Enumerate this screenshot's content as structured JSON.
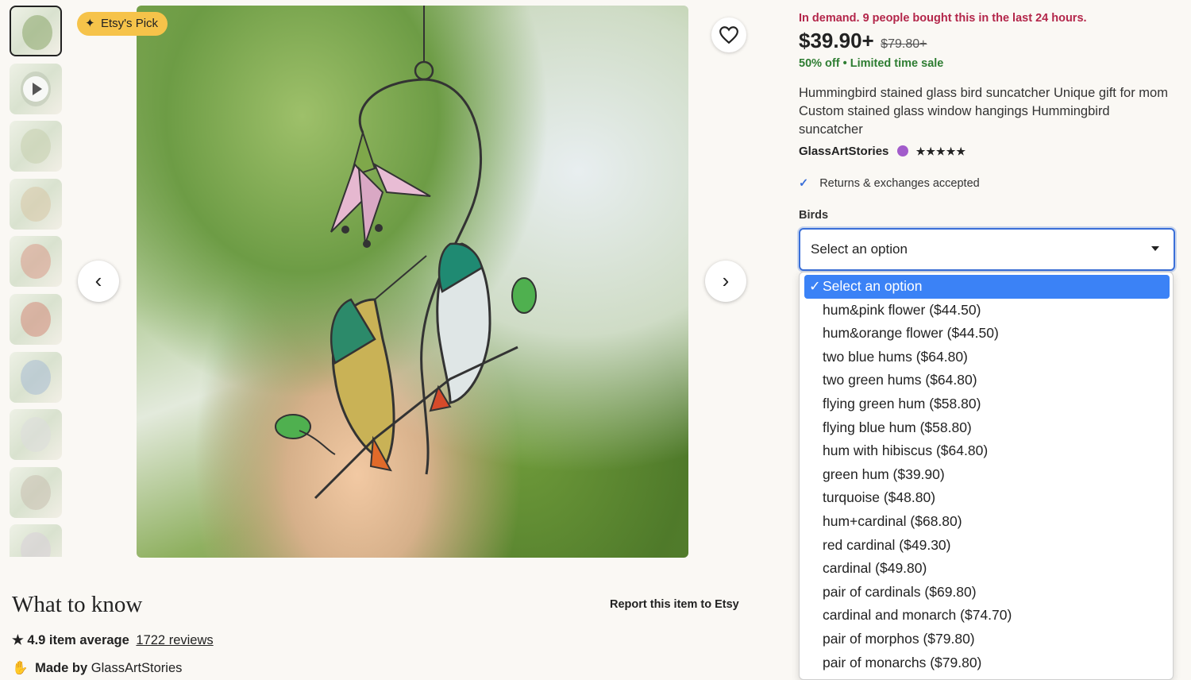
{
  "thumbnails": [
    {
      "kind": "image",
      "active": true,
      "color": "#8aa66a"
    },
    {
      "kind": "video",
      "active": false,
      "color": "#b9c3b0"
    },
    {
      "kind": "image",
      "active": false,
      "color": "#c7cfae"
    },
    {
      "kind": "image",
      "active": false,
      "color": "#d7c7a5"
    },
    {
      "kind": "image",
      "active": false,
      "color": "#d99a8a"
    },
    {
      "kind": "image",
      "active": false,
      "color": "#d48a7a"
    },
    {
      "kind": "image",
      "active": false,
      "color": "#a7bcd3"
    },
    {
      "kind": "image",
      "active": false,
      "color": "#dcdcdc"
    },
    {
      "kind": "image",
      "active": false,
      "color": "#c9c0b0"
    },
    {
      "kind": "image",
      "active": false,
      "color": "#d8d0d8"
    }
  ],
  "badge": {
    "label": "Etsy's Pick",
    "icon": "sparkle-icon"
  },
  "product": {
    "demand": "In demand. 9 people bought this in the last 24 hours.",
    "price": "$39.90+",
    "original_price": "$79.80+",
    "discount": "50% off",
    "sale_note": "Limited time sale",
    "title": "Hummingbird stained glass bird suncatcher Unique gift for mom Custom stained glass window hangings Hummingbird suncatcher",
    "shop": "GlassArtStories",
    "stars": "★★★★★",
    "returns": "Returns & exchanges accepted"
  },
  "variation": {
    "label": "Birds",
    "selected": "Select an option",
    "options": [
      "Select an option",
      "hum&pink flower ($44.50)",
      "hum&orange flower ($44.50)",
      "two blue hums ($64.80)",
      "two green hums ($64.80)",
      "flying green hum ($58.80)",
      "flying blue hum ($58.80)",
      "hum with hibiscus ($64.80)",
      "green hum ($39.90)",
      "turquoise ($48.80)",
      "hum+cardinal ($68.80)",
      "red cardinal ($49.30)",
      "cardinal ($49.80)",
      "pair of cardinals ($69.80)",
      "cardinal and monarch ($74.70)",
      "pair of morphos ($79.80)",
      "pair of monarchs ($79.80)"
    ]
  },
  "details": {
    "heading": "What to know",
    "report": "Report this item to Etsy",
    "rating": "4.9 item average",
    "reviews": "1722 reviews",
    "made_by_prefix": "Made by",
    "made_by_shop": "GlassArtStories"
  },
  "colors": {
    "accent": "#3b82f6",
    "demand": "#b3264a",
    "sale": "#2e7d32",
    "badge": "#f6c34a"
  }
}
